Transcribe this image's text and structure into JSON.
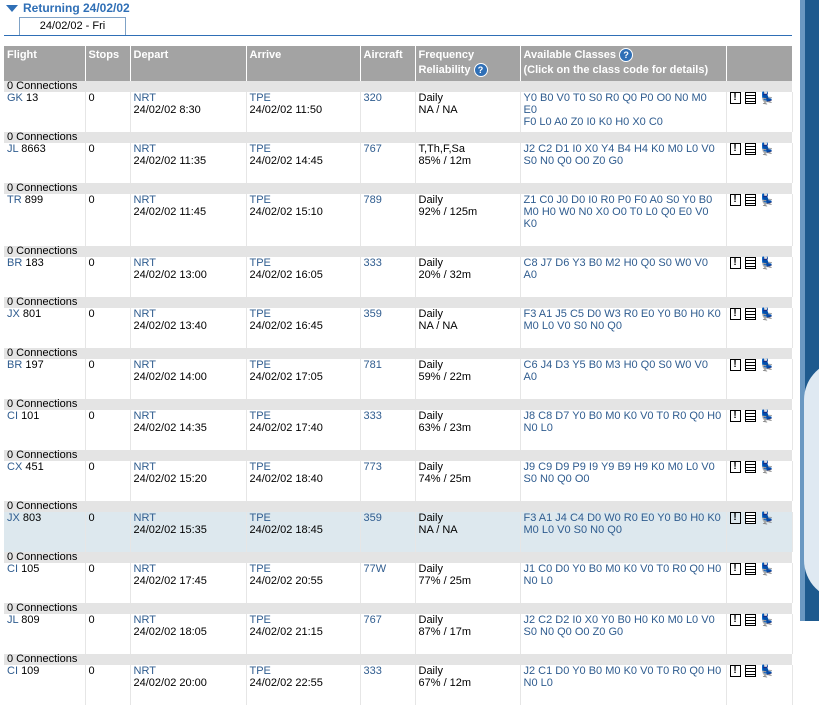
{
  "header": {
    "title": "Returning 24/02/02",
    "tab": "24/02/02 - Fri"
  },
  "columns": {
    "flight": "Flight",
    "stops": "Stops",
    "depart": "Depart",
    "arrive": "Arrive",
    "aircraft": "Aircraft",
    "frequency_line1": "Frequency",
    "frequency_line2": "Reliability",
    "classes_line1": "Available Classes",
    "classes_line2": "(Click on the class code for details)"
  },
  "flights": [
    {
      "connections": "0 Connections",
      "airline": "GK",
      "number": "13",
      "stops": "0",
      "dep_airport": "NRT",
      "dep_time": "24/02/02 8:30",
      "arr_airport": "TPE",
      "arr_time": "24/02/02 11:50",
      "aircraft": "320",
      "frequency": "Daily",
      "reliability": "NA / NA",
      "classes_1": "Y0 B0 V0 T0 S0 R0 Q0 P0 O0 N0 M0 E0",
      "classes_2": "F0 L0 A0 Z0 I0 K0 H0 X0 C0"
    },
    {
      "connections": "0 Connections",
      "airline": "JL",
      "number": "8663",
      "stops": "0",
      "dep_airport": "NRT",
      "dep_time": "24/02/02 11:35",
      "arr_airport": "TPE",
      "arr_time": "24/02/02 14:45",
      "aircraft": "767",
      "frequency": "T,Th,F,Sa",
      "reliability": "85% / 12m",
      "classes_1": "J2 C2 D1 I0 X0 Y4 B4 H4 K0 M0 L0 V0",
      "classes_2": "S0 N0 Q0 O0 Z0 G0"
    },
    {
      "connections": "0 Connections",
      "airline": "TR",
      "number": "899",
      "stops": "0",
      "dep_airport": "NRT",
      "dep_time": "24/02/02 11:45",
      "arr_airport": "TPE",
      "arr_time": "24/02/02 15:10",
      "aircraft": "789",
      "frequency": "Daily",
      "reliability": "92% / 125m",
      "classes_1": "Z1 C0 J0 D0 I0 R0 P0 F0 A0 S0 Y0 B0",
      "classes_2": "M0 H0 W0 N0 X0 O0 T0 L0 Q0 E0 V0",
      "classes_3": "K0"
    },
    {
      "connections": "0 Connections",
      "airline": "BR",
      "number": "183",
      "stops": "0",
      "dep_airport": "NRT",
      "dep_time": "24/02/02 13:00",
      "arr_airport": "TPE",
      "arr_time": "24/02/02 16:05",
      "aircraft": "333",
      "frequency": "Daily",
      "reliability": "20% / 32m",
      "classes_1": "C8 J7 D6 Y3 B0 M2 H0 Q0 S0 W0 V0",
      "classes_2": "A0"
    },
    {
      "connections": "0 Connections",
      "airline": "JX",
      "number": "801",
      "stops": "0",
      "dep_airport": "NRT",
      "dep_time": "24/02/02 13:40",
      "arr_airport": "TPE",
      "arr_time": "24/02/02 16:45",
      "aircraft": "359",
      "frequency": "Daily",
      "reliability": "NA / NA",
      "classes_1": "F3 A1 J5 C5 D0 W3 R0 E0 Y0 B0 H0 K0",
      "classes_2": "M0 L0 V0 S0 N0 Q0"
    },
    {
      "connections": "0 Connections",
      "airline": "BR",
      "number": "197",
      "stops": "0",
      "dep_airport": "NRT",
      "dep_time": "24/02/02 14:00",
      "arr_airport": "TPE",
      "arr_time": "24/02/02 17:05",
      "aircraft": "781",
      "frequency": "Daily",
      "reliability": "59% / 22m",
      "classes_1": "C6 J4 D3 Y5 B0 M3 H0 Q0 S0 W0 V0",
      "classes_2": "A0"
    },
    {
      "connections": "0 Connections",
      "airline": "CI",
      "number": "101",
      "stops": "0",
      "dep_airport": "NRT",
      "dep_time": "24/02/02 14:35",
      "arr_airport": "TPE",
      "arr_time": "24/02/02 17:40",
      "aircraft": "333",
      "frequency": "Daily",
      "reliability": "63% / 23m",
      "classes_1": "J8 C8 D7 Y0 B0 M0 K0 V0 T0 R0 Q0 H0",
      "classes_2": "N0 L0"
    },
    {
      "connections": "0 Connections",
      "airline": "CX",
      "number": "451",
      "stops": "0",
      "dep_airport": "NRT",
      "dep_time": "24/02/02 15:20",
      "arr_airport": "TPE",
      "arr_time": "24/02/02 18:40",
      "aircraft": "773",
      "frequency": "Daily",
      "reliability": "74% / 25m",
      "classes_1": "J9 C9 D9 P9 I9 Y9 B9 H9 K0 M0 L0 V0",
      "classes_2": "S0 N0 Q0 O0"
    },
    {
      "connections": "0 Connections",
      "airline": "JX",
      "number": "803",
      "stops": "0",
      "dep_airport": "NRT",
      "dep_time": "24/02/02 15:35",
      "arr_airport": "TPE",
      "arr_time": "24/02/02 18:45",
      "aircraft": "359",
      "frequency": "Daily",
      "reliability": "NA / NA",
      "classes_1": "F3 A1 J4 C4 D0 W0 R0 E0 Y0 B0 H0 K0",
      "classes_2": "M0 L0 V0 S0 N0 Q0",
      "highlight": true
    },
    {
      "connections": "0 Connections",
      "airline": "CI",
      "number": "105",
      "stops": "0",
      "dep_airport": "NRT",
      "dep_time": "24/02/02 17:45",
      "arr_airport": "TPE",
      "arr_time": "24/02/02 20:55",
      "aircraft": "77W",
      "frequency": "Daily",
      "reliability": "77% / 25m",
      "classes_1": "J1 C0 D0 Y0 B0 M0 K0 V0 T0 R0 Q0 H0",
      "classes_2": "N0 L0"
    },
    {
      "connections": "0 Connections",
      "airline": "JL",
      "number": "809",
      "stops": "0",
      "dep_airport": "NRT",
      "dep_time": "24/02/02 18:05",
      "arr_airport": "TPE",
      "arr_time": "24/02/02 21:15",
      "aircraft": "767",
      "frequency": "Daily",
      "reliability": "87% / 17m",
      "classes_1": "J2 C2 D2 I0 X0 Y0 B0 H0 K0 M0 L0 V0",
      "classes_2": "S0 N0 Q0 O0 Z0 G0"
    },
    {
      "connections": "0 Connections",
      "airline": "CI",
      "number": "109",
      "stops": "0",
      "dep_airport": "NRT",
      "dep_time": "24/02/02 20:00",
      "arr_airport": "TPE",
      "arr_time": "24/02/02 22:55",
      "aircraft": "333",
      "frequency": "Daily",
      "reliability": "67% / 12m",
      "classes_1": "J2 C1 D0 Y0 B0 M0 K0 V0 T0 R0 Q0 H0",
      "classes_2": "N0 L0"
    }
  ],
  "icons": {
    "excl": "!",
    "seat": "💺"
  },
  "colors": {
    "link": "#2f5c8f",
    "header_bg": "#a3a3a3",
    "accent": "#2f6fb6",
    "highlight_row": "#dde8ee"
  }
}
